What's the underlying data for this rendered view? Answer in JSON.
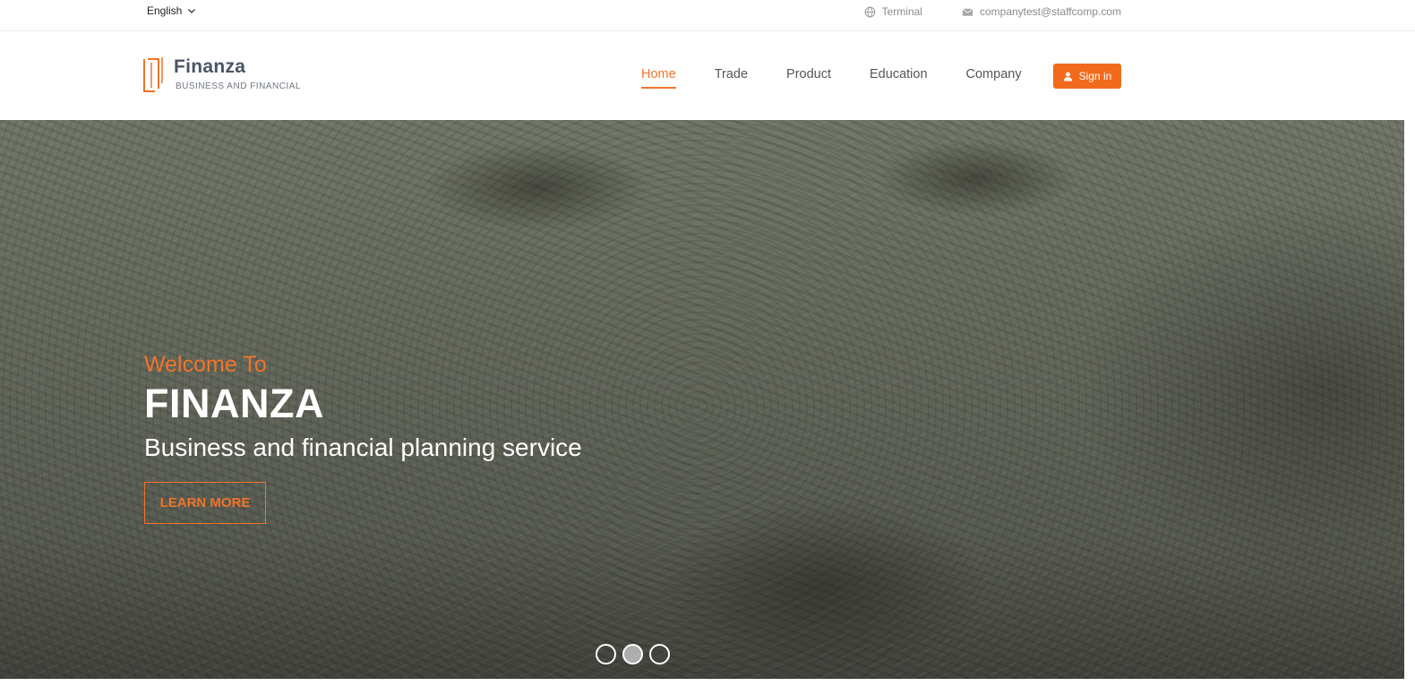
{
  "topbar": {
    "language": "English",
    "terminal": "Terminal",
    "email": "companytest@staffcomp.com"
  },
  "logo": {
    "name": "Finanza",
    "subtitle": "BUSINESS AND FINANCIAL"
  },
  "nav": {
    "items": [
      {
        "label": "Home",
        "active": true
      },
      {
        "label": "Trade",
        "active": false
      },
      {
        "label": "Product",
        "active": false
      },
      {
        "label": "Education",
        "active": false
      },
      {
        "label": "Company",
        "active": false
      }
    ],
    "signin": "Sign in"
  },
  "hero": {
    "welcome": "Welcome To",
    "brand": "FINANZA",
    "tagline": "Business and financial planning service",
    "cta": "LEARN MORE",
    "slides": 3,
    "active_slide": 2
  },
  "colors": {
    "accent": "#f26b1d",
    "nav_text": "#555555",
    "muted": "#8a8a8a"
  }
}
